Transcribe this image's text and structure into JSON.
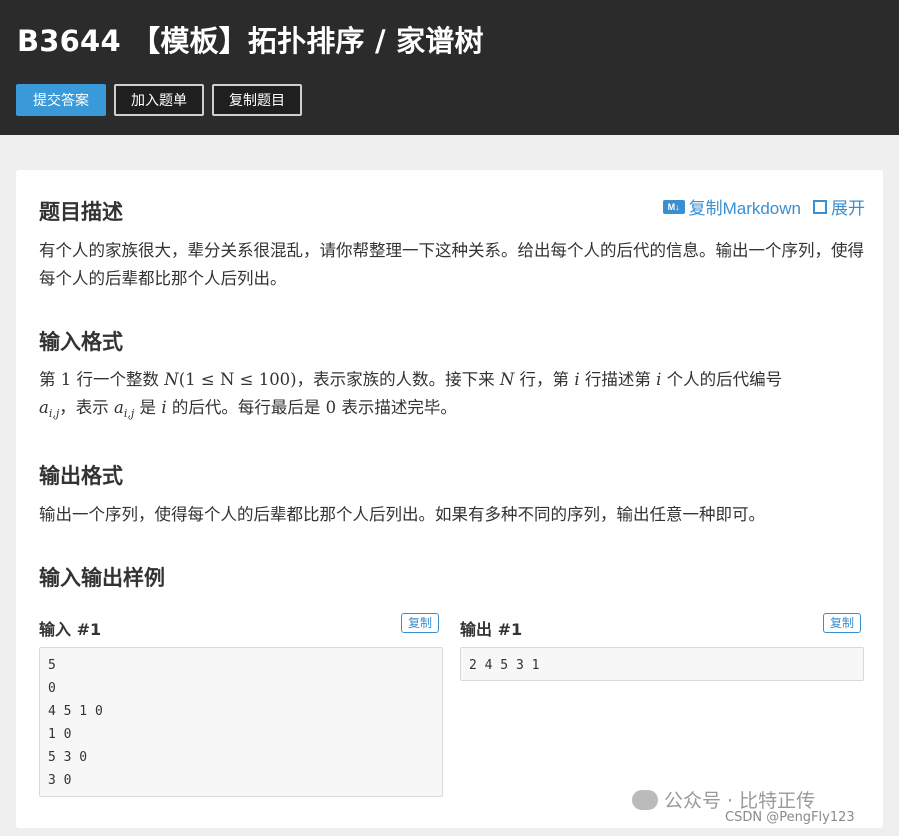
{
  "header": {
    "title": "B3644 【模板】拓扑排序 / 家谱树",
    "buttons": {
      "submit": "提交答案",
      "add_list": "加入题单",
      "copy_problem": "复制题目"
    }
  },
  "tools": {
    "copy_markdown": "复制Markdown",
    "expand": "展开"
  },
  "sections": {
    "description": {
      "heading": "题目描述",
      "text": "有个人的家族很大，辈分关系很混乱，请你帮整理一下这种关系。给出每个人的后代的信息。输出一个序列，使得每个人的后辈都比那个人后列出。"
    },
    "input": {
      "heading": "输入格式",
      "p1": "第 ",
      "n1": "1",
      "p2": " 行一个整数 ",
      "N": "N",
      "range": "(1 ≤ N ≤ 100)",
      "p3": "，表示家族的人数。接下来 ",
      "p4": " 行，第 ",
      "i": "i",
      "p5": " 行描述第 ",
      "p6": " 个人的后代编号",
      "a": "a",
      "ij": "i,j",
      "p7": "，表示 ",
      "p8": " 是 ",
      "p9": " 的后代。每行最后是 ",
      "zero": "0",
      "p10": " 表示描述完毕。"
    },
    "output": {
      "heading": "输出格式",
      "text": "输出一个序列，使得每个人的后辈都比那个人后列出。如果有多种不同的序列，输出任意一种即可。"
    },
    "samples": {
      "heading": "输入输出样例",
      "input_label": "输入 #1",
      "output_label": "输出 #1",
      "copy": "复制",
      "input_text": "5\n0\n4 5 1 0\n1 0\n5 3 0\n3 0",
      "output_text": "2 4 5 3 1"
    }
  },
  "watermark": {
    "text": "公众号 · 比特正传",
    "csdn": "CSDN @PengFly123"
  },
  "colors": {
    "header_bg": "#2b2b2b",
    "accent": "#3a9ad9",
    "page_bg": "#efefef"
  }
}
